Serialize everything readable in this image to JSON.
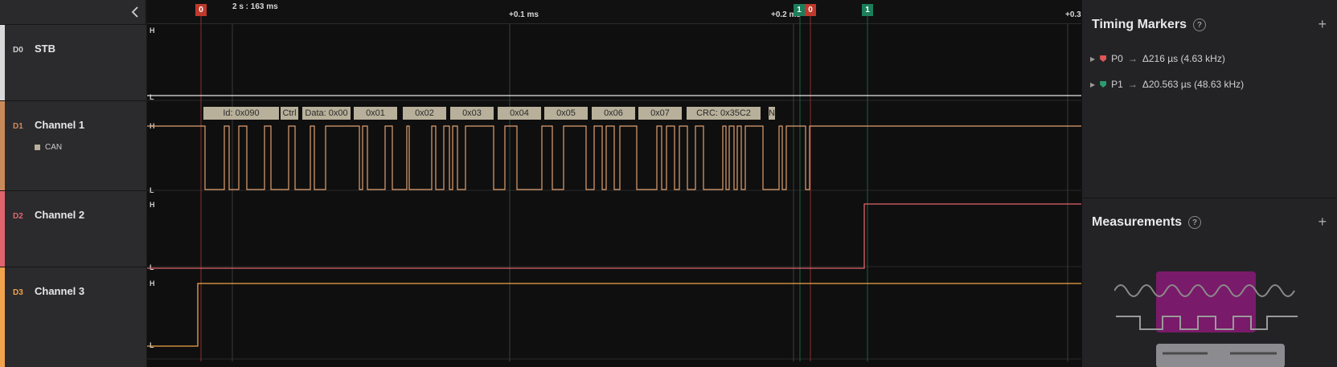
{
  "ruler": {
    "start_label": "2 s : 163 ms",
    "ticks": [
      "+0.1 ms",
      "+0.2 ms",
      "+0.3"
    ]
  },
  "markers": [
    {
      "label": "0",
      "color": "#c0392b"
    },
    {
      "label": "1",
      "color": "#1a7f5a"
    },
    {
      "label": "0",
      "color": "#c0392b"
    },
    {
      "label": "1",
      "color": "#1a7f5a"
    }
  ],
  "channels": [
    {
      "index": "D0",
      "name": "STB",
      "color": "#d9d9d9",
      "analyzer": ""
    },
    {
      "index": "D1",
      "name": "Channel 1",
      "color": "#c98a5a",
      "analyzer": "CAN"
    },
    {
      "index": "D2",
      "name": "Channel 2",
      "color": "#e0646e",
      "analyzer": ""
    },
    {
      "index": "D3",
      "name": "Channel 3",
      "color": "#f0a34a",
      "analyzer": ""
    }
  ],
  "level_labels": {
    "high": "H",
    "low": "L"
  },
  "can_frames": [
    "Id: 0x090",
    "Ctrl",
    "Data: 0x00",
    "0x01",
    "0x02",
    "0x03",
    "0x04",
    "0x05",
    "0x06",
    "0x07",
    "CRC: 0x35C2",
    "N"
  ],
  "panel": {
    "timing_title": "Timing Markers",
    "measurements_title": "Measurements",
    "help": "?",
    "add": "+",
    "arrow": "→",
    "timing_rows": [
      {
        "name": "P0",
        "color": "#e05555",
        "value": "Δ216 µs (4.63 kHz)"
      },
      {
        "name": "P1",
        "color": "#2a9c6e",
        "value": "Δ20.563 µs (48.63 kHz)"
      }
    ]
  },
  "icons": {
    "collapse": "chevron-left-icon",
    "expand": "caret-right-icon"
  }
}
